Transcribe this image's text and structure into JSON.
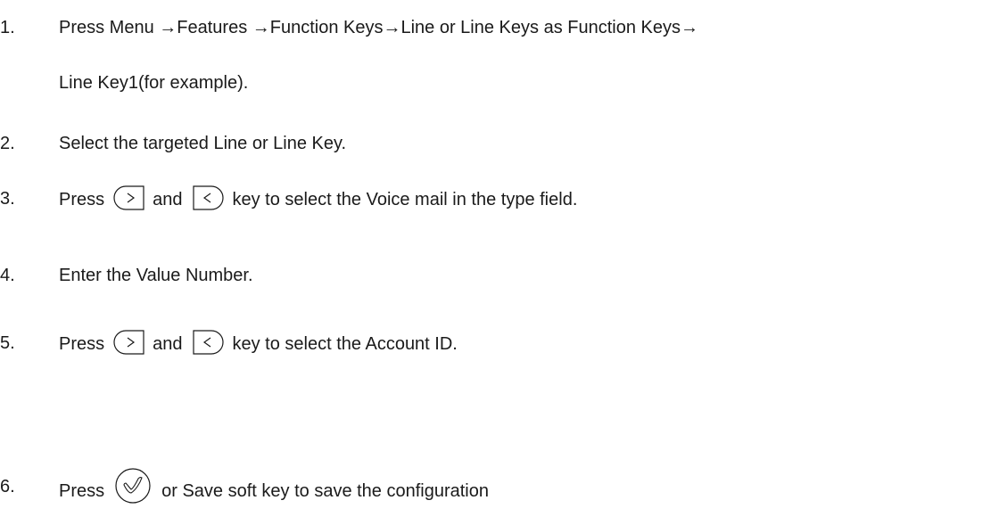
{
  "steps": [
    {
      "number": "1.",
      "line1": "Press Menu →Features →Function Keys→Line or Line Keys as Function Keys→",
      "line2": "Line Key1(for example)."
    },
    {
      "number": "2.",
      "text": "Select the targeted Line or Line Key."
    },
    {
      "number": "3.",
      "press": "Press",
      "and": "and",
      "rest": "key to select the Voice mail in the type field."
    },
    {
      "number": "4.",
      "text": "Enter the Value Number."
    },
    {
      "number": "5.",
      "press": "Press",
      "and": "and",
      "rest": "key to select the Account ID."
    },
    {
      "number": "6.",
      "press": "Press",
      "rest": "or Save soft key to save the configuration"
    }
  ],
  "icons": {
    "right": "right-arrow-key-icon",
    "left": "left-arrow-key-icon",
    "ok": "ok-check-key-icon"
  }
}
